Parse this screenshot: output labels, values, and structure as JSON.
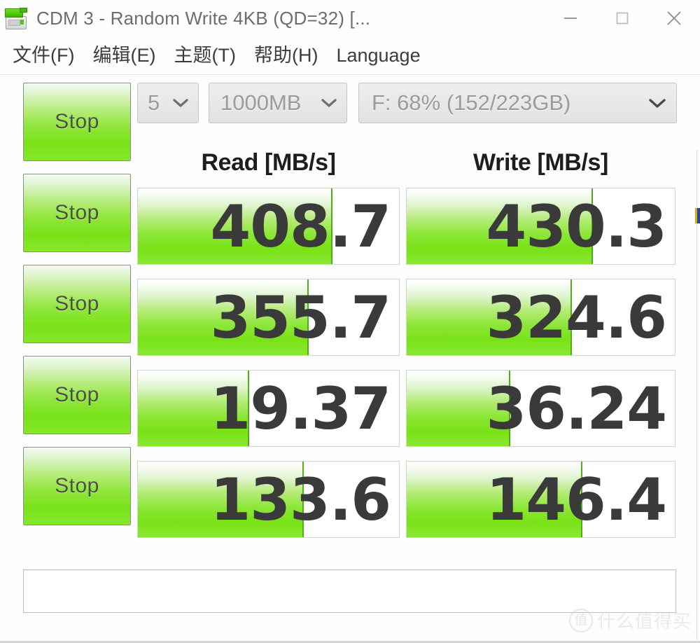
{
  "window": {
    "title": "CDM 3 - Random Write 4KB (QD=32) [...",
    "icon": "disk-drive-icon",
    "minimize_label": "minimize-icon",
    "maximize_label": "maximize-icon",
    "close_label": "close-icon"
  },
  "menu": {
    "items": [
      {
        "label": "文件(F)"
      },
      {
        "label": "编辑(E)"
      },
      {
        "label": "主题(T)"
      },
      {
        "label": "帮助(H)"
      },
      {
        "label": "Language"
      }
    ]
  },
  "toolbar": {
    "runs": {
      "value": "5",
      "disabled": true
    },
    "size": {
      "value": "1000MB",
      "disabled": true
    },
    "drive": {
      "value": "F: 68% (152/223GB)",
      "disabled": true
    },
    "stop_label": "Stop"
  },
  "headers": {
    "read": "Read [MB/s]",
    "write": "Write [MB/s]"
  },
  "results": [
    {
      "read": "408.7",
      "write": "430.3",
      "read_fill_pct": 74,
      "write_fill_pct": 69
    },
    {
      "read": "355.7",
      "write": "324.6",
      "read_fill_pct": 65,
      "write_fill_pct": 61
    },
    {
      "read": "19.37",
      "write": "36.24",
      "read_fill_pct": 42,
      "write_fill_pct": 38
    },
    {
      "read": "133.6",
      "write": "146.4",
      "read_fill_pct": 63,
      "write_fill_pct": 65
    }
  ],
  "comment": {
    "value": "",
    "placeholder": ""
  },
  "watermark": {
    "logo": "值",
    "text": "什么值得买"
  },
  "colors": {
    "green_bright": "#79E216",
    "green_edge": "#4FAE18",
    "value_text": "#3A3A3A",
    "title_text": "#6D6D6D",
    "menu_text": "#3C3C3C",
    "select_text": "#9B9B9B"
  }
}
